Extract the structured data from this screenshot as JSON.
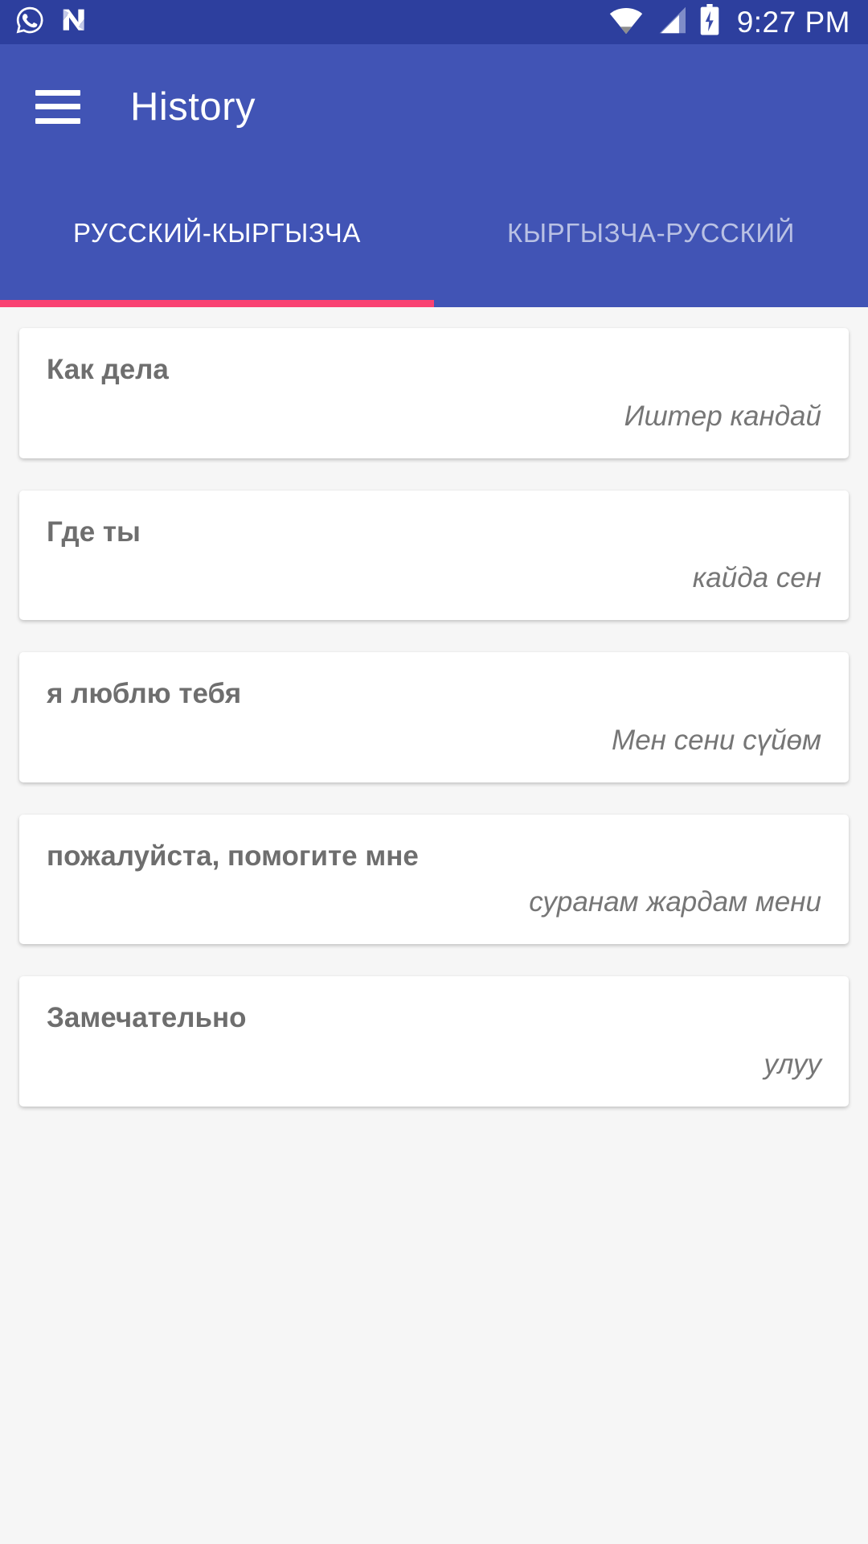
{
  "status_bar": {
    "icons_left": [
      "whatsapp-icon",
      "android-nougat-icon"
    ],
    "icons_right": [
      "wifi-icon",
      "cellular-signal-icon",
      "battery-charging-icon"
    ],
    "time": "9:27 PM",
    "background_color": "#2d3f9e"
  },
  "toolbar": {
    "menu_icon": "hamburger-menu-icon",
    "title": "History",
    "background_color": "#4154b5"
  },
  "tabs": {
    "items": [
      {
        "label": "РУССКИЙ-КЫРГЫЗЧА",
        "active": true
      },
      {
        "label": "КЫРГЫЗЧА-РУССКИЙ",
        "active": false
      }
    ],
    "indicator_color": "#f94272",
    "active_text_color": "#ffffff",
    "inactive_text_color": "#b9c1e4"
  },
  "history": {
    "items": [
      {
        "source": "Как дела",
        "target": "Иштер кандай"
      },
      {
        "source": "Где ты",
        "target": "кайда сен"
      },
      {
        "source": "я люблю тебя",
        "target": "Мен сени сүйөм"
      },
      {
        "source": "пожалуйста, помогите мне",
        "target": "суранам жардам мени"
      },
      {
        "source": "Замечательно",
        "target": "улуу"
      }
    ],
    "background_color": "#f6f6f6",
    "card_background": "#ffffff",
    "source_text_color": "#6e6e6e",
    "target_text_color": "#767676"
  }
}
